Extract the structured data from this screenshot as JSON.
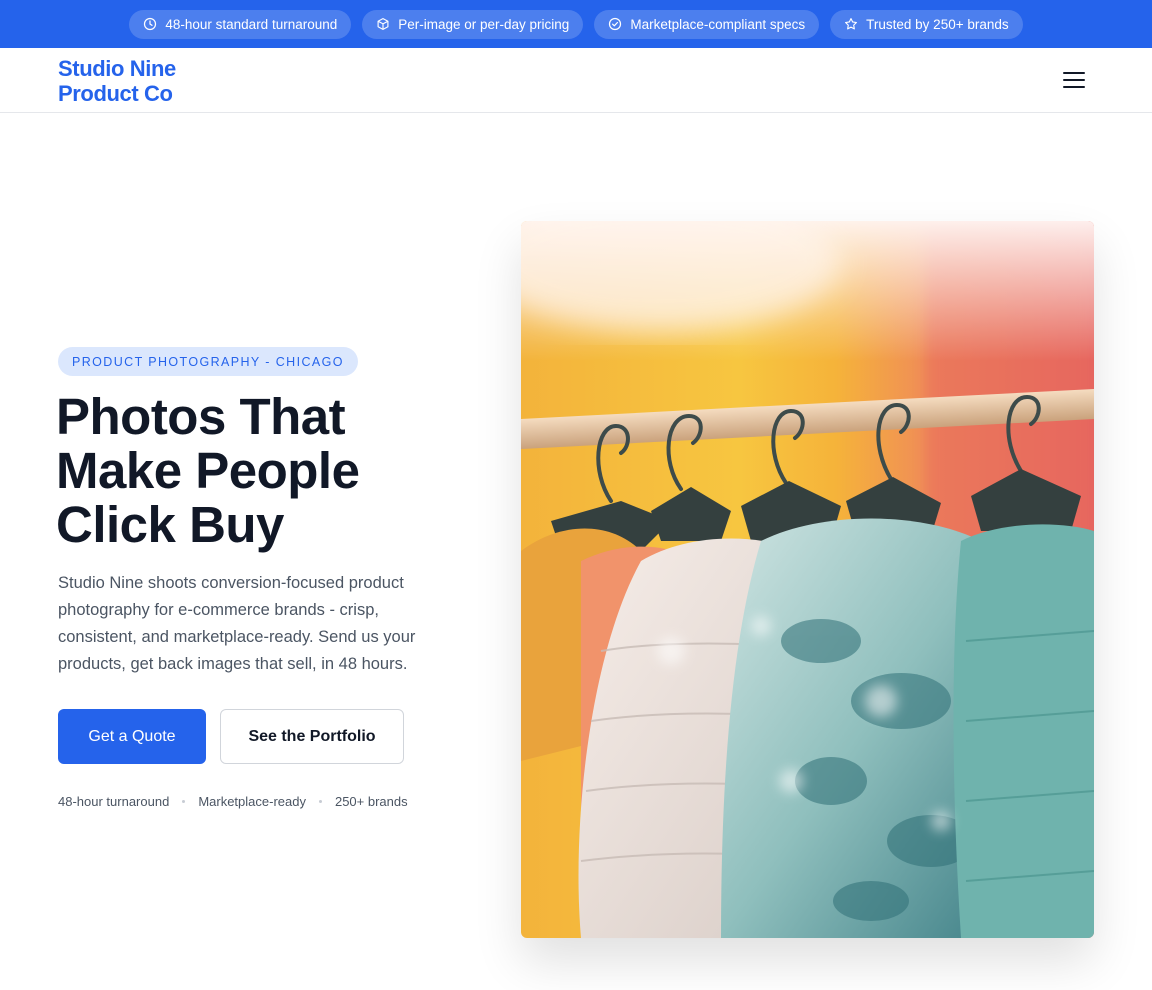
{
  "topbar": {
    "items": [
      {
        "icon": "clock-icon",
        "label": "48-hour standard turnaround"
      },
      {
        "icon": "box-icon",
        "label": "Per-image or per-day pricing"
      },
      {
        "icon": "check-circle-icon",
        "label": "Marketplace-compliant specs"
      },
      {
        "icon": "star-icon",
        "label": "Trusted by 250+ brands"
      }
    ],
    "background": "#2563eb"
  },
  "header": {
    "logo_line1": "Studio Nine",
    "logo_line2": "Product Co",
    "menu_icon": "hamburger-menu-icon"
  },
  "hero": {
    "eyebrow": "PRODUCT PHOTOGRAPHY - CHICAGO",
    "headline_line1": "Photos That",
    "headline_line2": "Make People",
    "headline_line3": "Click Buy",
    "lede": "Studio Nine shoots conversion-focused product photography for e-commerce brands - crisp, consistent, and marketplace-ready. Send us your products, get back images that sell, in 48 hours.",
    "primary_cta": "Get a Quote",
    "secondary_cta": "See the Portfolio",
    "stats": [
      "48-hour turnaround",
      "Marketplace-ready",
      "250+ brands"
    ],
    "image_subject": "puffer jackets on hangers on a clothing rail"
  },
  "colors": {
    "accent": "#2563eb",
    "text": "#111827",
    "muted": "#4b5563"
  }
}
